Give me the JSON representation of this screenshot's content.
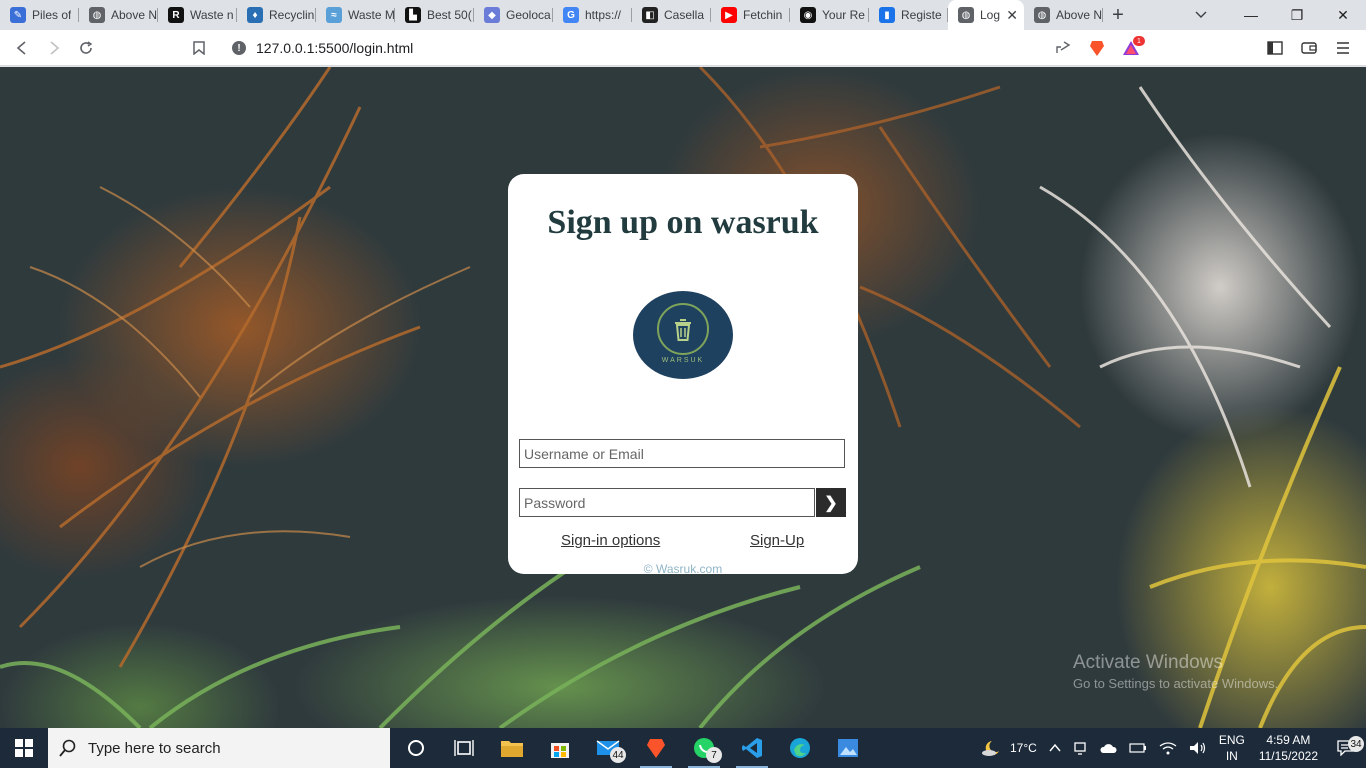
{
  "browser": {
    "tabs": [
      {
        "label": "Piles of",
        "fav_color": "#3b6fd8",
        "fav_glyph": "✎"
      },
      {
        "label": "Above N",
        "fav_color": "#5f6368",
        "fav_glyph": "◍"
      },
      {
        "label": "Waste n",
        "fav_color": "#111111",
        "fav_glyph": "R"
      },
      {
        "label": "Recyclin",
        "fav_color": "#2a6fb3",
        "fav_glyph": "♦"
      },
      {
        "label": "Waste M",
        "fav_color": "#5aa0d8",
        "fav_glyph": "≈"
      },
      {
        "label": "Best 50(",
        "fav_color": "#111111",
        "fav_glyph": "▙"
      },
      {
        "label": "Geoloca",
        "fav_color": "#6b7cd8",
        "fav_glyph": "◆"
      },
      {
        "label": "https://",
        "fav_color": "#4285f4",
        "fav_glyph": "G"
      },
      {
        "label": "Casella",
        "fav_color": "#222222",
        "fav_glyph": "◧"
      },
      {
        "label": "Fetchin",
        "fav_color": "#ff0000",
        "fav_glyph": "▶"
      },
      {
        "label": "Your Re",
        "fav_color": "#111111",
        "fav_glyph": "◉"
      },
      {
        "label": "Registe",
        "fav_color": "#1a73e8",
        "fav_glyph": "▮"
      },
      {
        "label": "Log",
        "fav_color": "#5f6368",
        "fav_glyph": "◍",
        "active": true
      },
      {
        "label": "Above N",
        "fav_color": "#5f6368",
        "fav_glyph": "◍"
      }
    ],
    "url": "127.0.0.1:5500/login.html"
  },
  "card": {
    "title": "Sign up on wasruk",
    "logo_text": "WARSUK",
    "username_placeholder": "Username or Email",
    "password_placeholder": "Password",
    "submit_glyph": "❯",
    "link_options": "Sign-in options",
    "link_signup": "Sign-Up",
    "copyright": "© Wasruk.com"
  },
  "watermark": {
    "line1": "Activate Windows",
    "line2": "Go to Settings to activate Windows."
  },
  "taskbar": {
    "search_placeholder": "Type here to search",
    "mail_badge": "44",
    "whatsapp_badge": "7",
    "weather": "17°C",
    "lang_top": "ENG",
    "lang_bottom": "IN",
    "time": "4:59 AM",
    "date": "11/15/2022",
    "notif_count": "34"
  },
  "colors": {
    "accent": "#1f4160",
    "title_text": "#223b3f",
    "taskbar": "#1c2a3a"
  }
}
